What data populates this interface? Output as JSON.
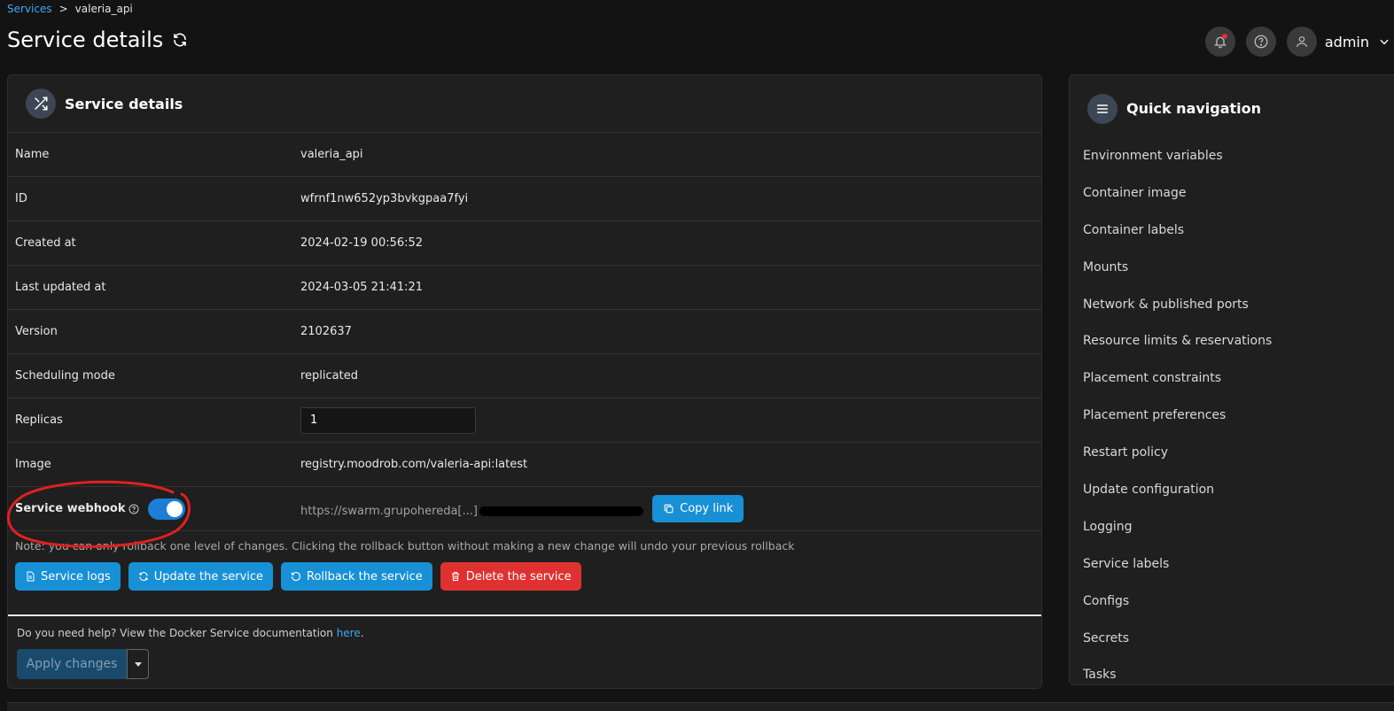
{
  "breadcrumb": {
    "parent": "Services",
    "separator": ">",
    "current": "valeria_api"
  },
  "page": {
    "title": "Service details"
  },
  "header": {
    "user": "admin"
  },
  "details_card": {
    "title": "Service details",
    "rows": [
      {
        "label": "Name",
        "value": "valeria_api"
      },
      {
        "label": "ID",
        "value": "wfrnf1nw652yp3bvkgpaa7fyi"
      },
      {
        "label": "Created at",
        "value": "2024-02-19 00:56:52"
      },
      {
        "label": "Last updated at",
        "value": "2024-03-05 21:41:21"
      },
      {
        "label": "Version",
        "value": "2102637"
      },
      {
        "label": "Scheduling mode",
        "value": "replicated"
      }
    ],
    "replicas": {
      "label": "Replicas",
      "value": "1"
    },
    "image": {
      "label": "Image",
      "value": "registry.moodrob.com/valeria-api:latest"
    },
    "webhook": {
      "label": "Service webhook",
      "enabled": true,
      "url": "https://swarm.grupohereda[...]",
      "copy_label": "Copy link"
    },
    "note": "Note: you can only rollback one level of changes. Clicking the rollback button without making a new change will undo your previous rollback",
    "actions": {
      "logs": "Service logs",
      "update": "Update the service",
      "rollback": "Rollback the service",
      "delete": "Delete the service"
    },
    "help": {
      "prefix": "Do you need help? View the Docker Service documentation ",
      "link": "here",
      "suffix": "."
    },
    "apply_label": "Apply changes"
  },
  "quick_nav": {
    "title": "Quick navigation",
    "items": [
      "Environment variables",
      "Container image",
      "Container labels",
      "Mounts",
      "Network & published ports",
      "Resource limits & reservations",
      "Placement constraints",
      "Placement preferences",
      "Restart policy",
      "Update configuration",
      "Logging",
      "Service labels",
      "Configs",
      "Secrets",
      "Tasks"
    ]
  },
  "colors": {
    "accent": "#1890d6",
    "danger": "#e03131",
    "annotation": "#e02020"
  }
}
